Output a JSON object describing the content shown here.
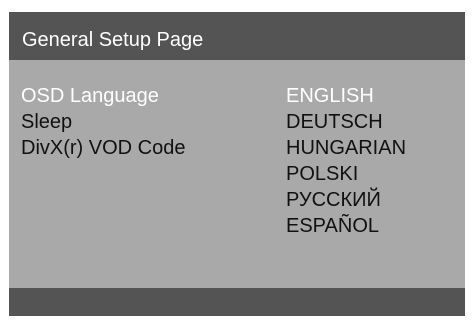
{
  "header": {
    "title": "General Setup Page"
  },
  "menu": {
    "items": [
      {
        "label": "OSD Language"
      },
      {
        "label": "Sleep"
      },
      {
        "label": "DivX(r) VOD Code"
      }
    ],
    "selected": "OSD Language"
  },
  "options": {
    "items": [
      {
        "label": "ENGLISH"
      },
      {
        "label": "DEUTSCH"
      },
      {
        "label": "HUNGARIAN"
      },
      {
        "label": "POLSKI"
      },
      {
        "label": "РУССКИЙ"
      },
      {
        "label": "ESPAÑOL"
      }
    ],
    "selected": "ENGLISH"
  },
  "colors": {
    "panel_background": "#a9a9a9",
    "header_background": "#545454",
    "footer_background": "#545454",
    "highlight_text": "#ffffff",
    "normal_text": "#111111"
  }
}
